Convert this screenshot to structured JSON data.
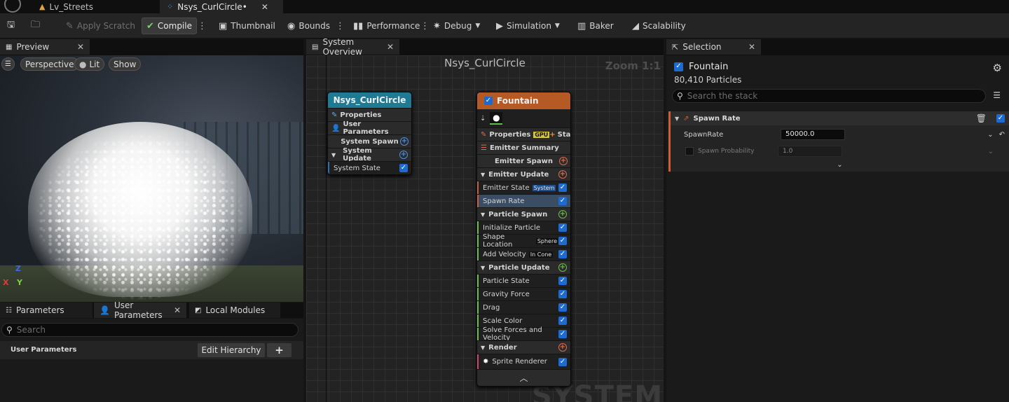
{
  "tabs": [
    {
      "label": "Lv_Streets",
      "active": false
    },
    {
      "label": "Nsys_CurlCircle•",
      "active": true
    }
  ],
  "toolbar": {
    "apply_scratch": "Apply Scratch",
    "compile": "Compile",
    "thumbnail": "Thumbnail",
    "bounds": "Bounds",
    "performance": "Performance",
    "debug": "Debug",
    "simulation": "Simulation",
    "baker": "Baker",
    "scalability": "Scalability"
  },
  "preview": {
    "tab": "Preview",
    "perspective": "Perspective",
    "lit": "Lit",
    "show": "Show",
    "axes": {
      "z": "Z",
      "y": "Y",
      "x": "X"
    }
  },
  "params": {
    "tabs": [
      "Parameters",
      "User Parameters",
      "Local Modules"
    ],
    "search_placeholder": "Search",
    "user_params_label": "User Parameters",
    "edit_hierarchy": "Edit Hierarchy",
    "add": "+"
  },
  "graph": {
    "tab": "System Overview",
    "title": "Nsys_CurlCircle",
    "zoom": "Zoom 1:1",
    "watermark": "SYSTEM",
    "system_node": {
      "title": "Nsys_CurlCircle",
      "rows": [
        "Properties",
        "User Parameters",
        "System Spawn",
        "System Update",
        "System State"
      ]
    },
    "emitter_node": {
      "title": "Fountain",
      "properties": "Properties",
      "gpu": "GPU",
      "stage": "Stage",
      "summary": "Emitter Summary",
      "emitter_spawn": "Emitter Spawn",
      "emitter_update": "Emitter Update",
      "emitter_state": "Emitter State",
      "emitter_state_tag": "System",
      "spawn_rate": "Spawn Rate",
      "particle_spawn": "Particle Spawn",
      "initialize_particle": "Initialize Particle",
      "shape_location": "Shape Location",
      "shape_location_tag": "Sphere",
      "add_velocity": "Add Velocity",
      "add_velocity_tag": "In Cone",
      "particle_update": "Particle Update",
      "particle_state": "Particle State",
      "gravity_force": "Gravity Force",
      "drag": "Drag",
      "scale_color": "Scale Color",
      "solve_forces": "Solve Forces and Velocity",
      "render": "Render",
      "sprite_renderer": "Sprite Renderer"
    }
  },
  "selection": {
    "tab": "Selection",
    "emitter_name": "Fountain",
    "particles": "80,410 Particles",
    "search_placeholder": "Search the stack",
    "module_title": "Spawn Rate",
    "spawn_rate_label": "SpawnRate",
    "spawn_rate_value": "50000.0",
    "spawn_probability_label": "Spawn Probability",
    "spawn_probability_value": "1.0"
  },
  "colors": {
    "system_header": "#1f7a94",
    "emitter_header": "#b55a25",
    "accent_blue": "#1d6ad1",
    "compile_green": "#7ad36b"
  }
}
